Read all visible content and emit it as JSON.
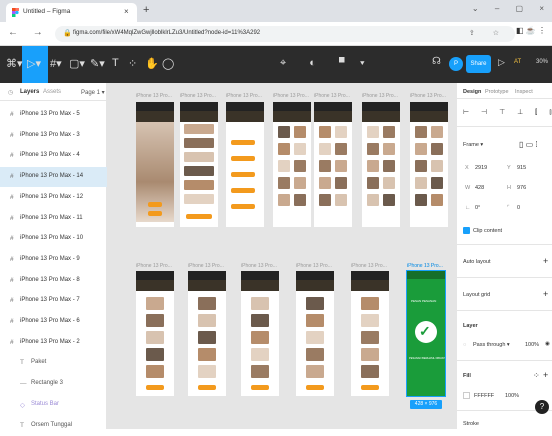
{
  "browser": {
    "tab_title": "Untitled – Figma",
    "tab_close": "×",
    "new_tab": "+",
    "window_buttons": [
      "⌄",
      "–",
      "▢",
      "×"
    ],
    "nav_icons": "← → C",
    "url": "figma.com/file/xW4MqlZwGwjlloblklrLZu3/Untitled?node-id=11%3A292",
    "url_icons": "⇪ ☆",
    "ext_icons": "◧ ☕ ⋮"
  },
  "toolbar": {
    "tools": [
      "⌘▾",
      "▷▾",
      "#▾",
      "▢▾",
      "✎▾",
      "T",
      "⁘",
      "✋",
      "◯"
    ],
    "center_tools": "⌖ ◐ ▝▾",
    "headset": "☊",
    "user_initial": "P",
    "share_label": "Share",
    "play": "▷",
    "ai_initial": "AT",
    "zoom": "30%"
  },
  "left_panel": {
    "tab_icon": "◷",
    "tab_layers": "Layers",
    "tab_assets": "Assets",
    "page_label": "Page 1 ▾",
    "layers": [
      "iPhone 13 Pro Max - 5",
      "iPhone 13 Pro Max - 3",
      "iPhone 13 Pro Max - 4",
      "iPhone 13 Pro Max - 14",
      "iPhone 13 Pro Max - 12",
      "iPhone 13 Pro Max - 11",
      "iPhone 13 Pro Max - 10",
      "iPhone 13 Pro Max - 9",
      "iPhone 13 Pro Max - 8",
      "iPhone 13 Pro Max - 7",
      "iPhone 13 Pro Max - 6",
      "iPhone 13 Pro Max - 2"
    ],
    "sublayers": [
      {
        "icon": "T",
        "name": "Paket"
      },
      {
        "icon": "—",
        "name": "Rectangle 3"
      },
      {
        "icon": "◇",
        "name": "Status Bar"
      },
      {
        "icon": "T",
        "name": "Orsem Tunggal"
      }
    ],
    "hash": "#"
  },
  "canvas": {
    "frame_label": "iPhone 13 Pro...",
    "check": "✓",
    "green_text_top": "PESAN PESANAN",
    "green_text_bottom": "PESANAN BERHASIL DIBUAT",
    "dim_badge": "428 × 976"
  },
  "right_panel": {
    "tabs": [
      "Design",
      "Prototype",
      "Inspect"
    ],
    "align_icons": "⊢ ⊣ ⊤ ⊥ ⫿ ⫾",
    "frame_label": "Frame ▾",
    "x_label": "X",
    "x_value": "2919",
    "y_label": "Y",
    "y_value": "915",
    "w_label": "W",
    "w_value": "428",
    "h_label": "H",
    "h_value": "976",
    "r_label": "∟",
    "r_value": "0°",
    "c_label": "⌜",
    "c_value": "0",
    "clip_label": "Clip content",
    "auto_layout": "Auto layout",
    "layout_grid": "Layout grid",
    "layer_title": "Layer",
    "blend": "Pass through ▾",
    "opacity": "100%",
    "fill_title": "Fill",
    "fill_hex": "FFFFFF",
    "fill_opacity": "100%",
    "stroke_title": "Stroke",
    "plus": "+",
    "help": "?"
  }
}
